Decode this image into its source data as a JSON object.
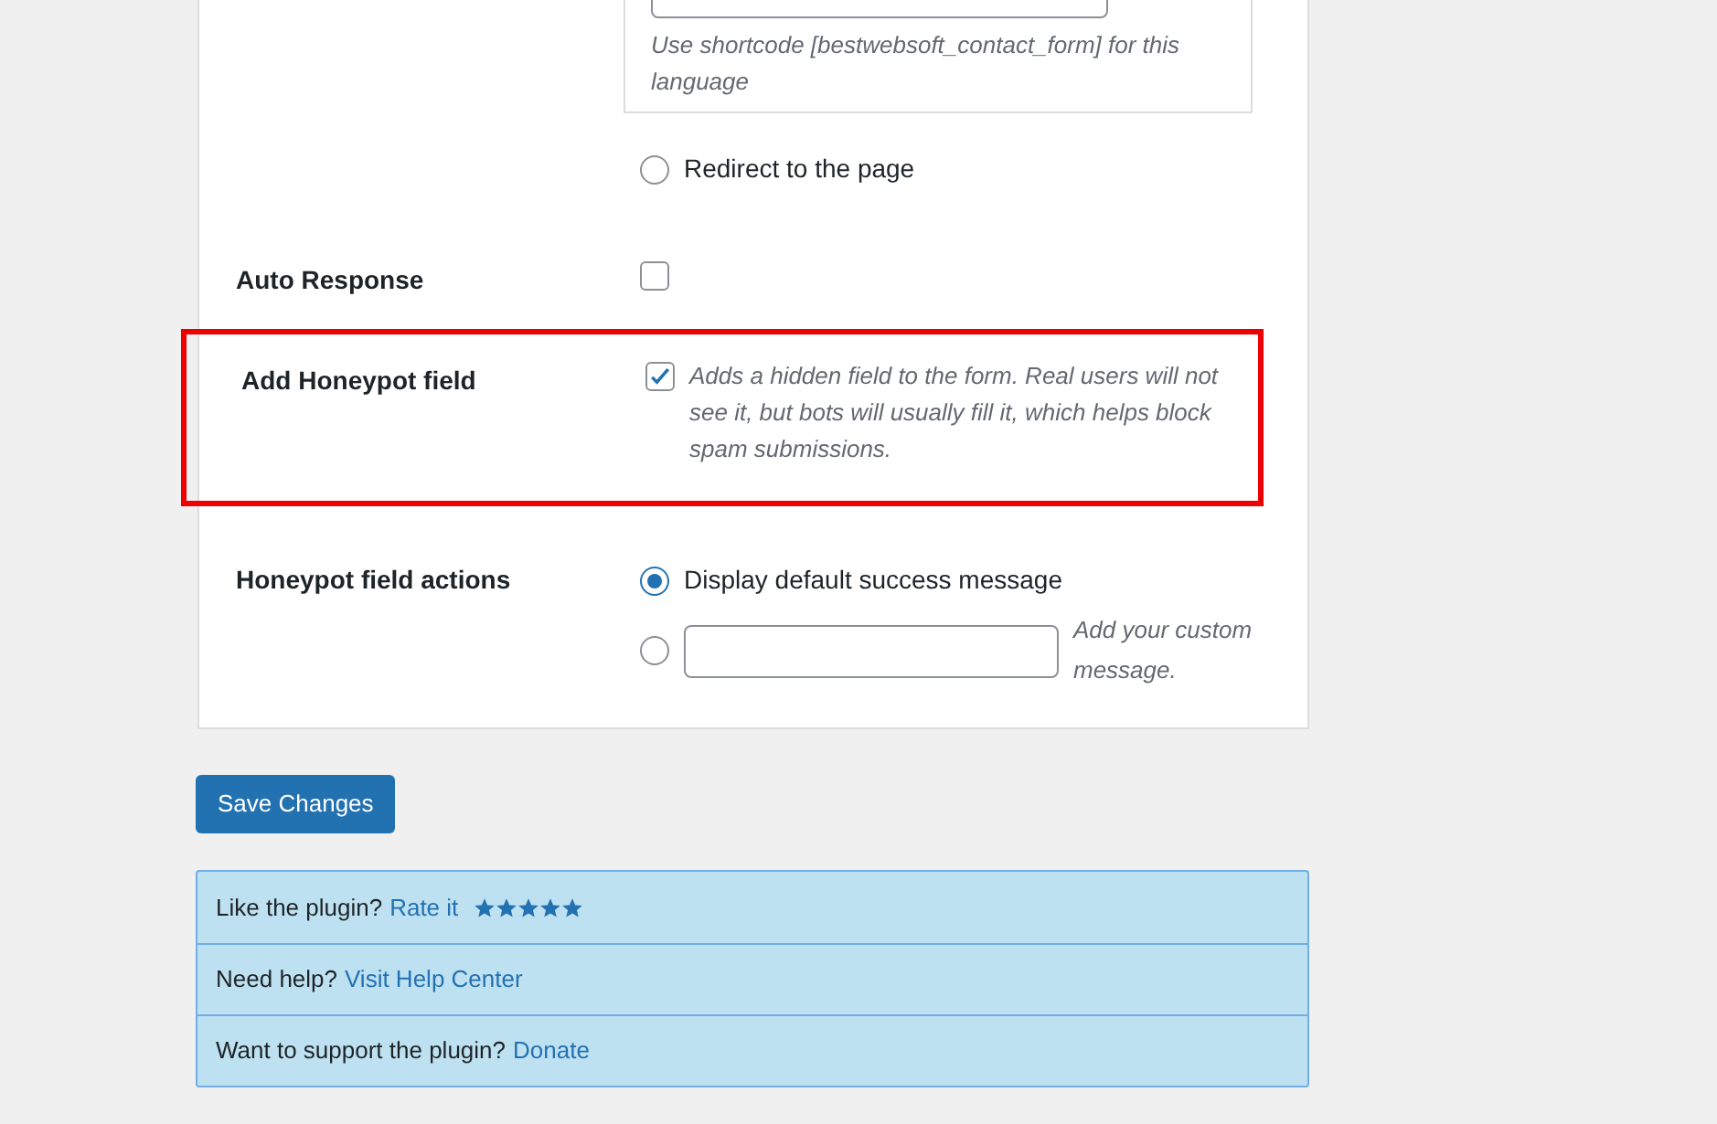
{
  "language_box": {
    "hint": "Use shortcode [bestwebsoft_contact_form] for this language"
  },
  "redirect_option": {
    "label": "Redirect to the page",
    "selected": false
  },
  "rows": [
    {
      "kind": "checkbox",
      "label": "Auto Response",
      "checked": false
    },
    {
      "kind": "checkbox",
      "label": "Add Honeypot field",
      "checked": true,
      "highlighted": true,
      "description": "Adds a hidden field to the form. Real users will not see it, but bots will usually fill it, which helps block spam submissions."
    },
    {
      "kind": "radios",
      "label": "Honeypot field actions",
      "options": [
        {
          "kind": "text",
          "label": "Display default success message",
          "selected": true
        },
        {
          "kind": "custom",
          "hint": "Add your custom message.",
          "selected": false
        }
      ]
    }
  ],
  "save_button": "Save Changes",
  "footer": [
    {
      "text": "Like the plugin?",
      "link": "Rate it",
      "stars": 5
    },
    {
      "text": "Need help?",
      "link": "Visit Help Center"
    },
    {
      "text": "Want to support the plugin?",
      "link": "Donate"
    }
  ]
}
